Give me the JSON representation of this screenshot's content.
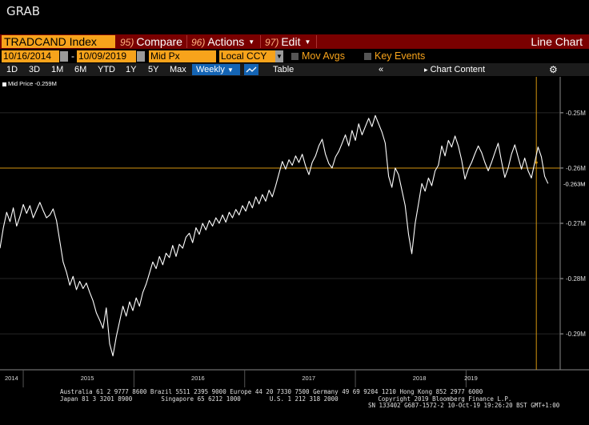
{
  "window": {
    "title": "GRAB"
  },
  "command_bar": {
    "ticker": "TRADCAND Index",
    "compare": {
      "num": "95)",
      "label": "Compare"
    },
    "actions": {
      "num": "96)",
      "label": "Actions"
    },
    "edit": {
      "num": "97)",
      "label": "Edit"
    },
    "right_title": "Line Chart"
  },
  "settings_row": {
    "start_date": "10/16/2014",
    "end_date": "10/09/2019",
    "field": "Mid Px",
    "currency": "Local CCY",
    "mov_avgs": "Mov Avgs",
    "key_events": "Key Events"
  },
  "toolbar": {
    "periods": [
      "1D",
      "3D",
      "1M",
      "6M",
      "YTD",
      "1Y",
      "5Y",
      "Max"
    ],
    "frequency": "Weekly",
    "table": "Table",
    "chart_content": "Chart Content"
  },
  "chart_data": {
    "type": "line",
    "legend": "Mid Price -0.259M",
    "last_value_label": "-0.263M",
    "crosshair_value": -0.26,
    "y_ticks": [
      "-0.25M",
      "-0.26M",
      "-0.27M",
      "-0.28M",
      "-0.29M"
    ],
    "y_tick_values": [
      -0.25,
      -0.26,
      -0.27,
      -0.28,
      -0.29
    ],
    "ylim": [
      -0.2965,
      -0.2435
    ],
    "x_year_labels": [
      "2014",
      "2015",
      "2016",
      "2017",
      "2018",
      "2019"
    ],
    "x_year_positions": [
      2014.79,
      2015.0,
      2016.0,
      2017.0,
      2018.0,
      2019.0
    ],
    "xlim": [
      2014.79,
      2019.85
    ],
    "series": [
      {
        "values": [
          [
            2014.79,
            -0.2745
          ],
          [
            2014.82,
            -0.2708
          ],
          [
            2014.85,
            -0.268
          ],
          [
            2014.88,
            -0.2697
          ],
          [
            2014.91,
            -0.2672
          ],
          [
            2014.94,
            -0.2705
          ],
          [
            2014.97,
            -0.2688
          ],
          [
            2015.0,
            -0.2666
          ],
          [
            2015.03,
            -0.2682
          ],
          [
            2015.06,
            -0.2668
          ],
          [
            2015.09,
            -0.269
          ],
          [
            2015.12,
            -0.2676
          ],
          [
            2015.15,
            -0.2662
          ],
          [
            2015.18,
            -0.2677
          ],
          [
            2015.21,
            -0.269
          ],
          [
            2015.24,
            -0.2685
          ],
          [
            2015.27,
            -0.2674
          ],
          [
            2015.3,
            -0.2695
          ],
          [
            2015.33,
            -0.2732
          ],
          [
            2015.36,
            -0.277
          ],
          [
            2015.39,
            -0.2788
          ],
          [
            2015.42,
            -0.2812
          ],
          [
            2015.45,
            -0.2796
          ],
          [
            2015.48,
            -0.282
          ],
          [
            2015.51,
            -0.2805
          ],
          [
            2015.54,
            -0.2818
          ],
          [
            2015.57,
            -0.2808
          ],
          [
            2015.6,
            -0.2825
          ],
          [
            2015.63,
            -0.284
          ],
          [
            2015.66,
            -0.2862
          ],
          [
            2015.69,
            -0.2875
          ],
          [
            2015.72,
            -0.289
          ],
          [
            2015.75,
            -0.2853
          ],
          [
            2015.78,
            -0.2918
          ],
          [
            2015.81,
            -0.294
          ],
          [
            2015.84,
            -0.2905
          ],
          [
            2015.87,
            -0.2878
          ],
          [
            2015.9,
            -0.285
          ],
          [
            2015.93,
            -0.2868
          ],
          [
            2015.96,
            -0.2842
          ],
          [
            2015.99,
            -0.2858
          ],
          [
            2016.02,
            -0.2835
          ],
          [
            2016.05,
            -0.285
          ],
          [
            2016.08,
            -0.2825
          ],
          [
            2016.11,
            -0.281
          ],
          [
            2016.14,
            -0.279
          ],
          [
            2016.17,
            -0.277
          ],
          [
            2016.2,
            -0.2782
          ],
          [
            2016.23,
            -0.276
          ],
          [
            2016.26,
            -0.2775
          ],
          [
            2016.29,
            -0.2754
          ],
          [
            2016.32,
            -0.2762
          ],
          [
            2016.35,
            -0.274
          ],
          [
            2016.38,
            -0.276
          ],
          [
            2016.41,
            -0.2738
          ],
          [
            2016.44,
            -0.2745
          ],
          [
            2016.47,
            -0.2725
          ],
          [
            2016.5,
            -0.2718
          ],
          [
            2016.53,
            -0.2735
          ],
          [
            2016.56,
            -0.2708
          ],
          [
            2016.59,
            -0.272
          ],
          [
            2016.62,
            -0.27
          ],
          [
            2016.65,
            -0.2712
          ],
          [
            2016.68,
            -0.2695
          ],
          [
            2016.71,
            -0.2705
          ],
          [
            2016.74,
            -0.269
          ],
          [
            2016.77,
            -0.27
          ],
          [
            2016.8,
            -0.2685
          ],
          [
            2016.83,
            -0.2698
          ],
          [
            2016.86,
            -0.268
          ],
          [
            2016.89,
            -0.269
          ],
          [
            2016.92,
            -0.2675
          ],
          [
            2016.95,
            -0.2685
          ],
          [
            2016.98,
            -0.2668
          ],
          [
            2017.01,
            -0.2678
          ],
          [
            2017.04,
            -0.266
          ],
          [
            2017.07,
            -0.2672
          ],
          [
            2017.1,
            -0.2652
          ],
          [
            2017.13,
            -0.2665
          ],
          [
            2017.16,
            -0.2648
          ],
          [
            2017.19,
            -0.266
          ],
          [
            2017.22,
            -0.264
          ],
          [
            2017.25,
            -0.2652
          ],
          [
            2017.28,
            -0.2632
          ],
          [
            2017.31,
            -0.261
          ],
          [
            2017.34,
            -0.2588
          ],
          [
            2017.37,
            -0.2602
          ],
          [
            2017.4,
            -0.2585
          ],
          [
            2017.43,
            -0.2595
          ],
          [
            2017.46,
            -0.2578
          ],
          [
            2017.49,
            -0.259
          ],
          [
            2017.52,
            -0.2575
          ],
          [
            2017.55,
            -0.2596
          ],
          [
            2017.58,
            -0.2612
          ],
          [
            2017.61,
            -0.259
          ],
          [
            2017.64,
            -0.2578
          ],
          [
            2017.67,
            -0.256
          ],
          [
            2017.7,
            -0.2548
          ],
          [
            2017.73,
            -0.2575
          ],
          [
            2017.76,
            -0.2592
          ],
          [
            2017.79,
            -0.26
          ],
          [
            2017.82,
            -0.258
          ],
          [
            2017.85,
            -0.257
          ],
          [
            2017.88,
            -0.2555
          ],
          [
            2017.91,
            -0.254
          ],
          [
            2017.94,
            -0.256
          ],
          [
            2017.97,
            -0.2532
          ],
          [
            2018.0,
            -0.255
          ],
          [
            2018.03,
            -0.252
          ],
          [
            2018.06,
            -0.254
          ],
          [
            2018.09,
            -0.2525
          ],
          [
            2018.12,
            -0.251
          ],
          [
            2018.15,
            -0.2525
          ],
          [
            2018.18,
            -0.2505
          ],
          [
            2018.21,
            -0.252
          ],
          [
            2018.24,
            -0.2535
          ],
          [
            2018.27,
            -0.2555
          ],
          [
            2018.3,
            -0.2615
          ],
          [
            2018.33,
            -0.2635
          ],
          [
            2018.36,
            -0.26
          ],
          [
            2018.39,
            -0.2612
          ],
          [
            2018.42,
            -0.264
          ],
          [
            2018.45,
            -0.2668
          ],
          [
            2018.48,
            -0.272
          ],
          [
            2018.51,
            -0.2755
          ],
          [
            2018.54,
            -0.27
          ],
          [
            2018.57,
            -0.2665
          ],
          [
            2018.6,
            -0.2628
          ],
          [
            2018.63,
            -0.2642
          ],
          [
            2018.66,
            -0.2618
          ],
          [
            2018.69,
            -0.2632
          ],
          [
            2018.72,
            -0.2605
          ],
          [
            2018.75,
            -0.2595
          ],
          [
            2018.78,
            -0.256
          ],
          [
            2018.81,
            -0.2578
          ],
          [
            2018.84,
            -0.255
          ],
          [
            2018.87,
            -0.2562
          ],
          [
            2018.9,
            -0.2542
          ],
          [
            2018.93,
            -0.256
          ],
          [
            2018.96,
            -0.2586
          ],
          [
            2018.99,
            -0.262
          ],
          [
            2019.02,
            -0.2602
          ],
          [
            2019.05,
            -0.259
          ],
          [
            2019.08,
            -0.2574
          ],
          [
            2019.11,
            -0.256
          ],
          [
            2019.14,
            -0.2572
          ],
          [
            2019.17,
            -0.259
          ],
          [
            2019.2,
            -0.2605
          ],
          [
            2019.23,
            -0.259
          ],
          [
            2019.26,
            -0.2572
          ],
          [
            2019.29,
            -0.2555
          ],
          [
            2019.32,
            -0.2588
          ],
          [
            2019.35,
            -0.2617
          ],
          [
            2019.38,
            -0.26
          ],
          [
            2019.41,
            -0.2575
          ],
          [
            2019.44,
            -0.2558
          ],
          [
            2019.47,
            -0.258
          ],
          [
            2019.5,
            -0.2602
          ],
          [
            2019.53,
            -0.2582
          ],
          [
            2019.56,
            -0.2605
          ],
          [
            2019.59,
            -0.2618
          ],
          [
            2019.62,
            -0.259
          ],
          [
            2019.65,
            -0.2562
          ],
          [
            2019.68,
            -0.258
          ],
          [
            2019.71,
            -0.2615
          ],
          [
            2019.74,
            -0.2628
          ]
        ]
      }
    ],
    "colors": {
      "line": "#ffffff",
      "crosshair": "#d4950f",
      "grid": "#262626",
      "accent": "#f7a31b"
    }
  },
  "footer": {
    "line1": "Australia 61 2 9777 8600 Brazil 5511 2395 9000 Europe 44 20 7330 7500 Germany 49 69 9204 1210 Hong Kong 852 2977 6000",
    "line2": "Japan 81 3 3201 8900        Singapore 65 6212 1000        U.S. 1 212 318 2000           Copyright 2019 Bloomberg Finance L.P.",
    "line3": "SN 133402 G687-1572-2 10-Oct-19 19:26:20 BST  GMT+1:00"
  }
}
